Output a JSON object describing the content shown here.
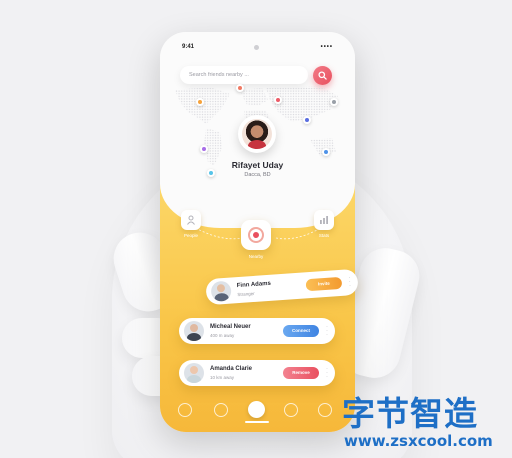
{
  "status_bar": {
    "time": "9:41",
    "signal": "••••"
  },
  "search": {
    "placeholder": "Search friends nearby ..."
  },
  "profile": {
    "name": "Rifayet Uday",
    "location": "Dacca, BD"
  },
  "modes": [
    {
      "label": "People",
      "icon": "person-icon"
    },
    {
      "label": "Nearby",
      "icon": "radar-icon"
    },
    {
      "label": "Stats",
      "icon": "bar-chart-icon"
    }
  ],
  "contacts": [
    {
      "name": "Finn Adams",
      "subtitle": "Stranger",
      "action": "Invite",
      "action_color": "#f6a23a"
    },
    {
      "name": "Micheal Neuer",
      "subtitle": "400 m away",
      "action": "Connect",
      "action_color": "#4f93e8"
    },
    {
      "name": "Amanda Clarie",
      "subtitle": "10 km away",
      "action": "Remove",
      "action_color": "#ec5b68"
    }
  ],
  "tabbar": [
    "home-icon",
    "location-icon",
    "nearby-icon",
    "trophy-icon",
    "settings-icon"
  ],
  "watermark": {
    "title": "字节智造",
    "url": "www.zsxcool.com"
  },
  "colors": {
    "accent_yellow": "#f9c547",
    "danger": "#e9505f",
    "primary_blue": "#4f93e8"
  }
}
